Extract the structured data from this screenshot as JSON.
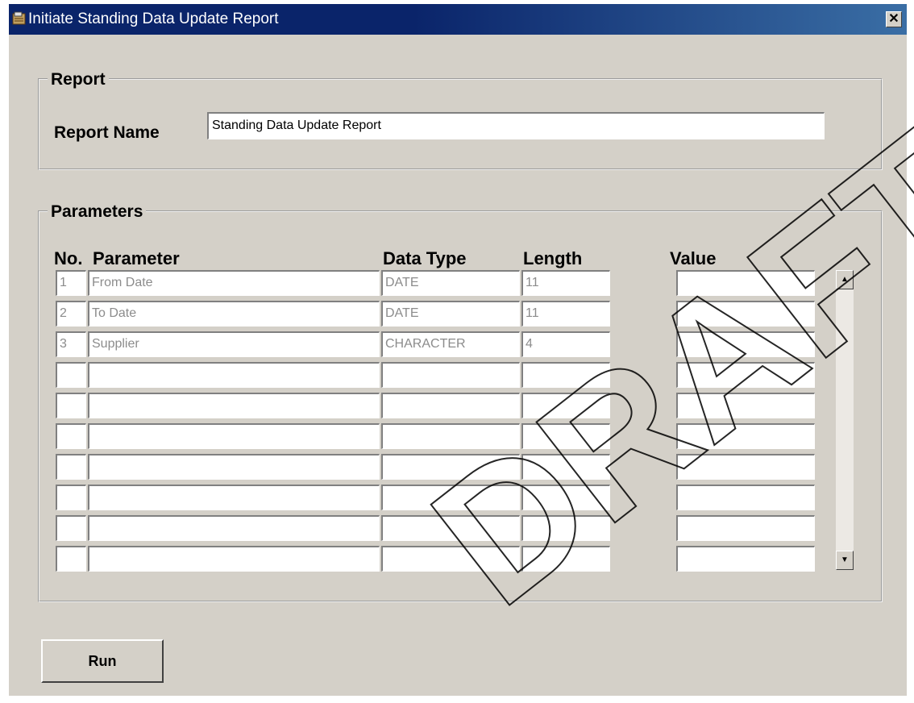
{
  "window": {
    "title": "Initiate Standing Data Update Report",
    "close_glyph": "✕"
  },
  "report_group": {
    "title": "Report",
    "name_label": "Report Name",
    "name_value": "Standing Data Update Report"
  },
  "parameters_group": {
    "title": "Parameters",
    "columns": {
      "no": "No.",
      "parameter": "Parameter",
      "data_type": "Data Type",
      "length": "Length",
      "value": "Value"
    },
    "rows": [
      {
        "no": "1",
        "parameter": "From Date",
        "data_type": "DATE",
        "length": "11",
        "value": ""
      },
      {
        "no": "2",
        "parameter": "To Date",
        "data_type": "DATE",
        "length": "11",
        "value": ""
      },
      {
        "no": "3",
        "parameter": "Supplier",
        "data_type": "CHARACTER",
        "length": "4",
        "value": ""
      },
      {
        "no": "",
        "parameter": "",
        "data_type": "",
        "length": "",
        "value": ""
      },
      {
        "no": "",
        "parameter": "",
        "data_type": "",
        "length": "",
        "value": ""
      },
      {
        "no": "",
        "parameter": "",
        "data_type": "",
        "length": "",
        "value": ""
      },
      {
        "no": "",
        "parameter": "",
        "data_type": "",
        "length": "",
        "value": ""
      },
      {
        "no": "",
        "parameter": "",
        "data_type": "",
        "length": "",
        "value": ""
      },
      {
        "no": "",
        "parameter": "",
        "data_type": "",
        "length": "",
        "value": ""
      },
      {
        "no": "",
        "parameter": "",
        "data_type": "",
        "length": "",
        "value": ""
      }
    ]
  },
  "scrollbar": {
    "up_glyph": "▲",
    "down_glyph": "▼"
  },
  "run_button": {
    "label": "Run"
  },
  "watermark": {
    "text": "DRAFT"
  },
  "icons": {
    "app": "app-icon",
    "close": "close-icon"
  },
  "colors": {
    "titlebar": "#0a246a",
    "window_bg": "#d4d0c8",
    "field_text_muted": "#8c8c8c"
  }
}
